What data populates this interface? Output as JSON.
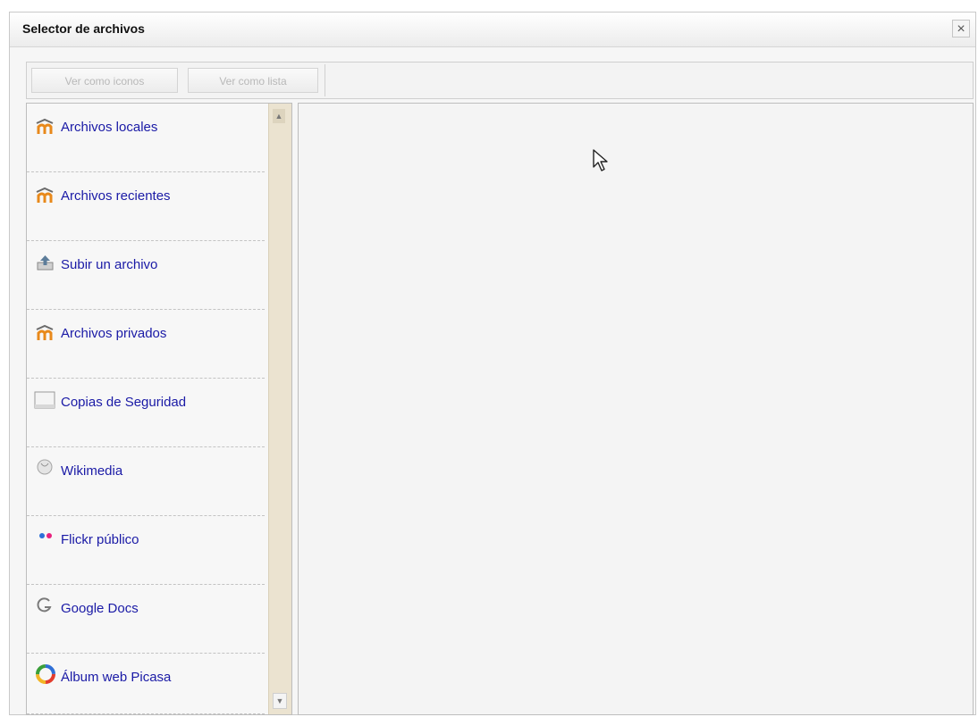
{
  "dialog": {
    "title": "Selector de archivos",
    "close_label": "×"
  },
  "toolbar": {
    "view_icons_label": "Ver como iconos",
    "view_list_label": "Ver como lista"
  },
  "repositories": [
    {
      "label": "Archivos locales",
      "icon": "moodle-icon"
    },
    {
      "label": "Archivos recientes",
      "icon": "moodle-icon"
    },
    {
      "label": "Subir un archivo",
      "icon": "upload-icon"
    },
    {
      "label": "Archivos privados",
      "icon": "moodle-icon"
    },
    {
      "label": "Copias de Seguridad",
      "icon": "backup-icon"
    },
    {
      "label": "Wikimedia",
      "icon": "wikimedia-icon"
    },
    {
      "label": "Flickr público",
      "icon": "flickr-icon"
    },
    {
      "label": "Google Docs",
      "icon": "google-icon"
    },
    {
      "label": "Álbum web Picasa",
      "icon": "picasa-icon"
    }
  ],
  "colors": {
    "link": "#1a1aa6",
    "moodle_orange": "#e8891b",
    "scrollbar_track": "#ebe3d0"
  }
}
